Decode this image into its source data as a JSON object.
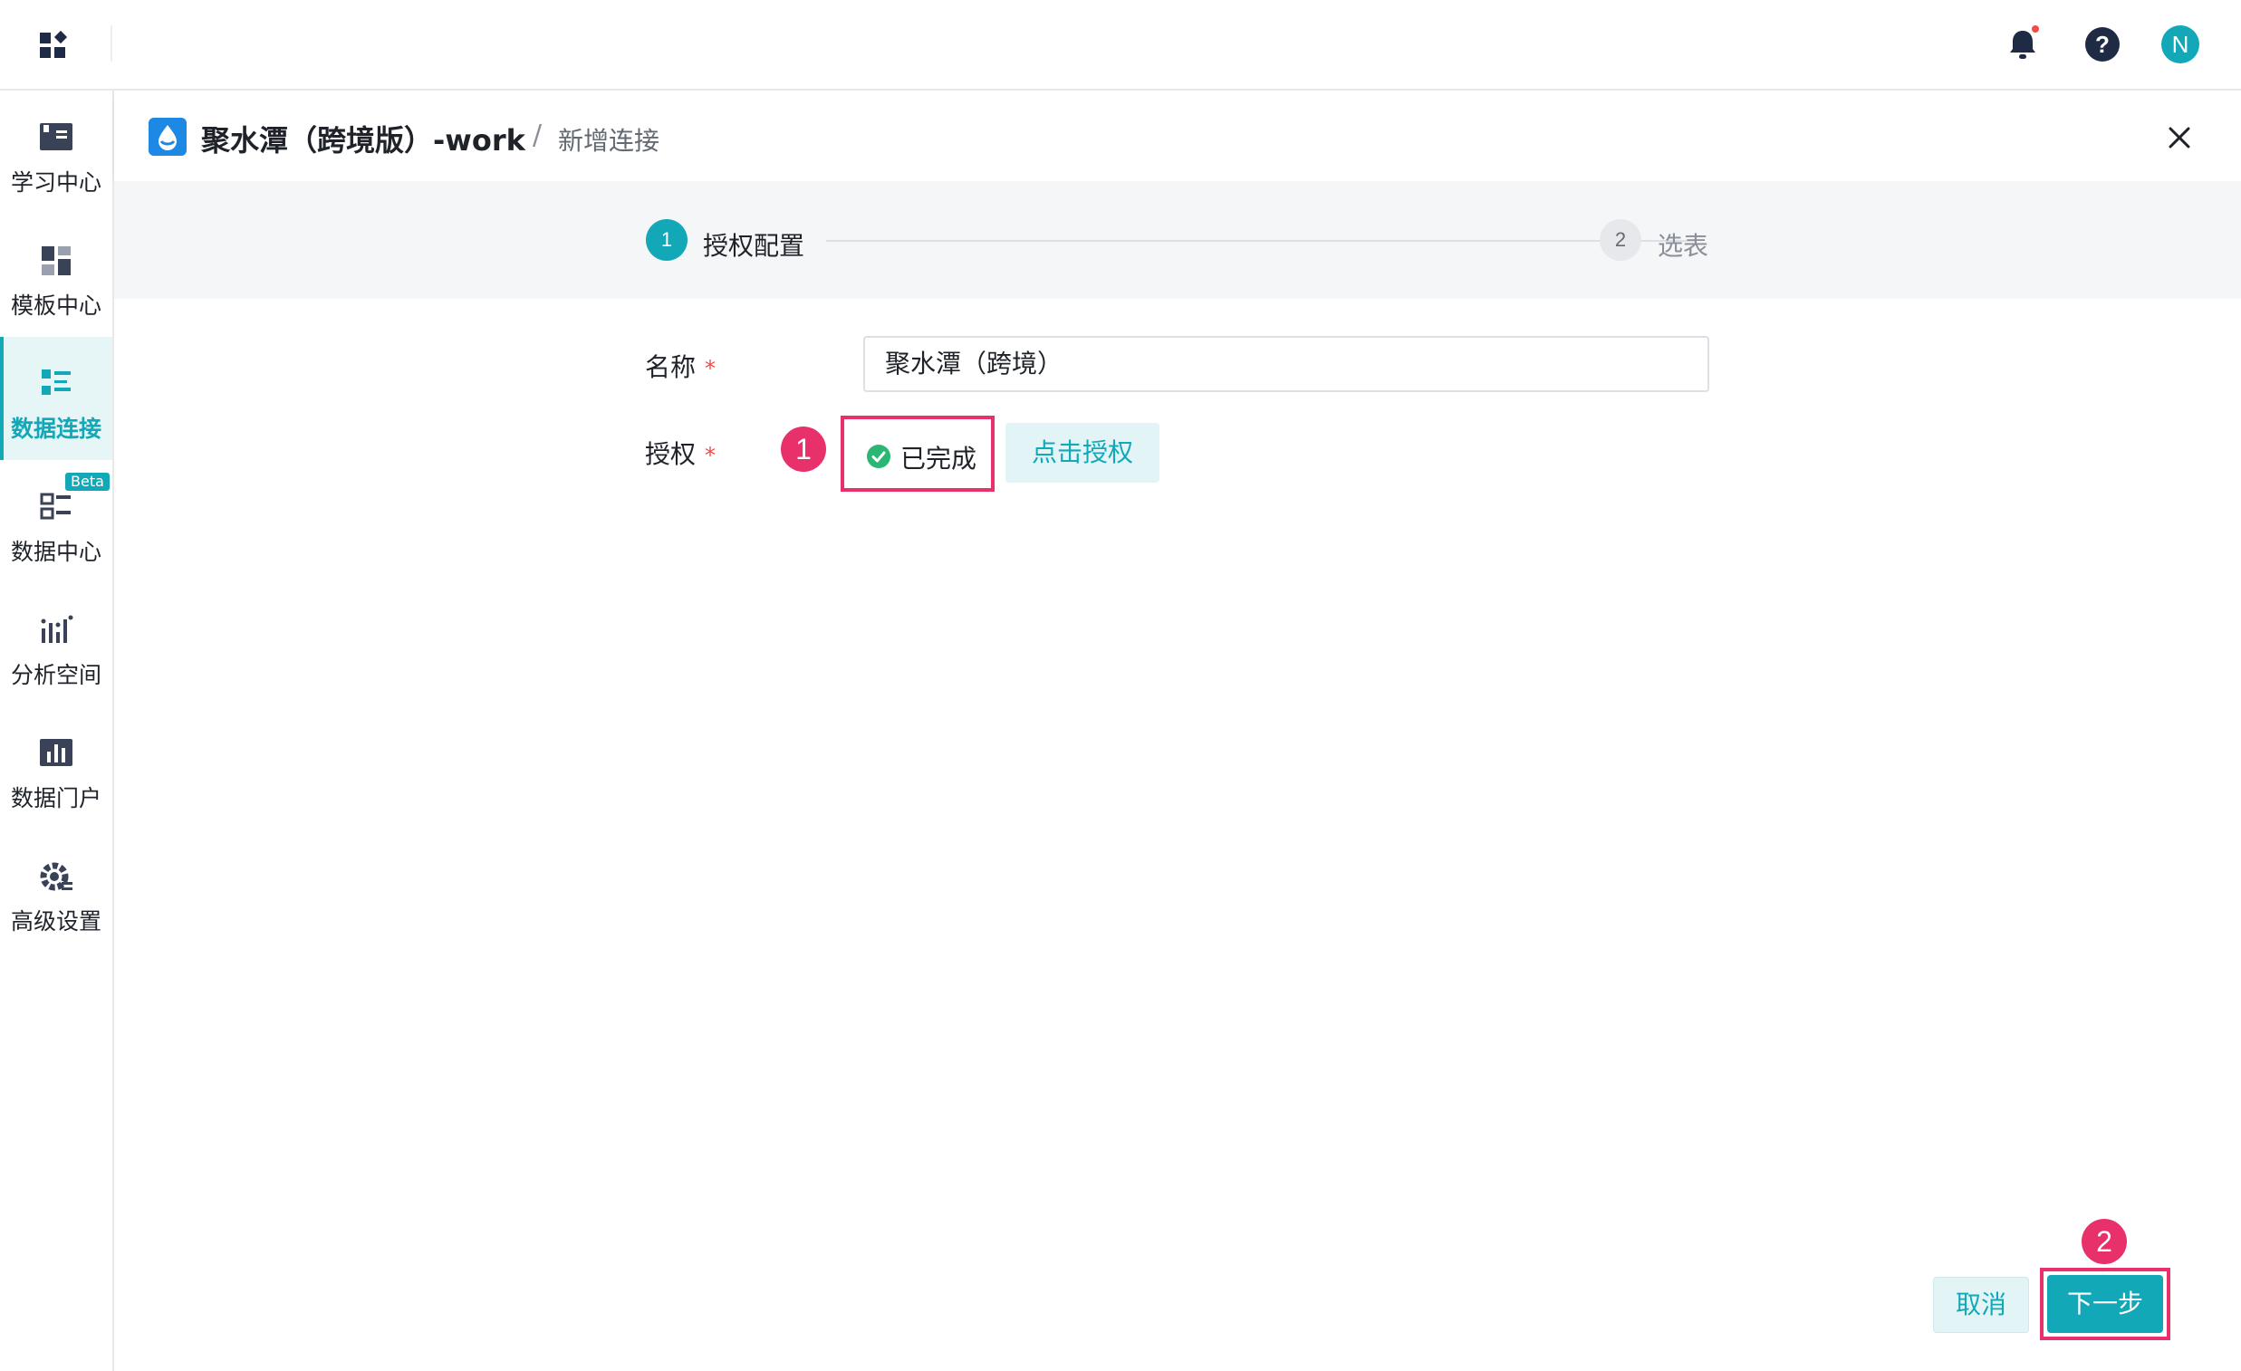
{
  "topbar": {
    "app_grid_icon": "app-grid-icon",
    "notification_icon": "bell-icon",
    "help_icon": "question-icon",
    "user_initial": "N"
  },
  "sidebar": {
    "items": [
      {
        "label": "学习中心",
        "icon": "book-icon"
      },
      {
        "label": "模板中心",
        "icon": "template-icon"
      },
      {
        "label": "数据连接",
        "icon": "data-connect-icon",
        "active": true
      },
      {
        "label": "数据中心",
        "icon": "data-center-icon",
        "badge": "Beta"
      },
      {
        "label": "分析空间",
        "icon": "analysis-icon"
      },
      {
        "label": "数据门户",
        "icon": "portal-icon"
      },
      {
        "label": "高级设置",
        "icon": "gear-icon"
      }
    ]
  },
  "header": {
    "title": "聚水潭（跨境版）-work",
    "separator": "/",
    "subtitle": "新增连接"
  },
  "steps": [
    {
      "number": "1",
      "label": "授权配置",
      "active": true
    },
    {
      "number": "2",
      "label": "选表",
      "active": false
    }
  ],
  "form": {
    "name_label": "名称",
    "name_value": "聚水潭（跨境）",
    "auth_label": "授权",
    "required_mark": "*",
    "auth_status": "已完成",
    "auth_button": "点击授权"
  },
  "annotations": {
    "marker1": "1",
    "marker2": "2"
  },
  "footer": {
    "cancel_label": "取消",
    "next_label": "下一步"
  },
  "colors": {
    "accent": "#12a8b8",
    "highlight": "#e8306a",
    "success": "#2bb673"
  }
}
